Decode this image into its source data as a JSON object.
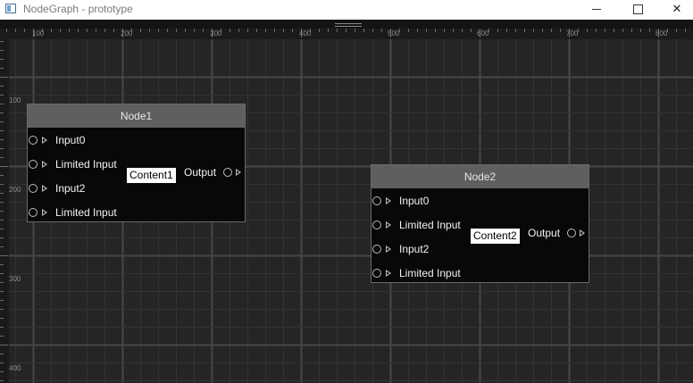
{
  "window": {
    "title": "NodeGraph - prototype",
    "minimize_icon": "minimize-icon",
    "maximize_icon": "maximize-icon",
    "close_label": "✕"
  },
  "rulers": {
    "horizontal_labels": [
      "100",
      "200",
      "300",
      "400",
      "500",
      "600",
      "700",
      "800"
    ],
    "vertical_labels": [
      "100",
      "200",
      "300",
      "400"
    ]
  },
  "colors": {
    "canvas_bg": "#252525",
    "node_body": "#080808",
    "node_header": "#5f5f5f",
    "port_outline": "#bdbdbd"
  },
  "nodes": [
    {
      "title": "Node1",
      "inputs": [
        "Input0",
        "Limited Input",
        "Input2",
        "Limited Input"
      ],
      "content": "Content1",
      "output": "Output"
    },
    {
      "title": "Node2",
      "inputs": [
        "Input0",
        "Limited Input",
        "Input2",
        "Limited Input"
      ],
      "content": "Content2",
      "output": "Output"
    }
  ]
}
